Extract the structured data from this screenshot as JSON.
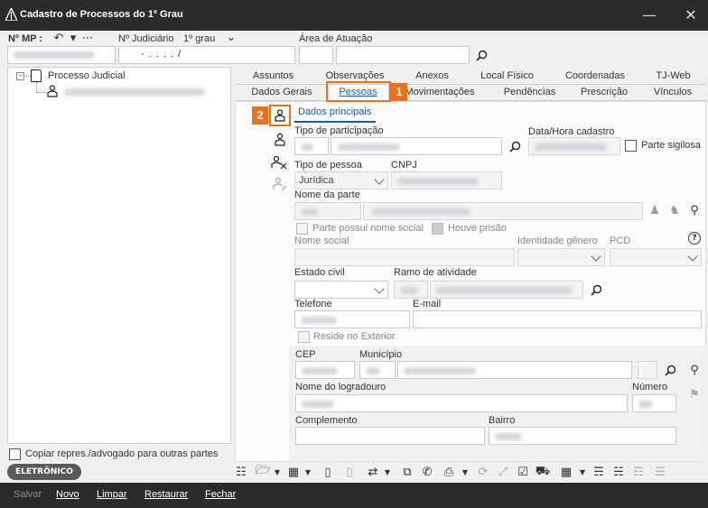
{
  "window": {
    "title": "Cadastro de Processos do 1º Grau",
    "minimize_icon": "minimize-icon",
    "close_icon": "close-icon"
  },
  "header": {
    "mp_label": "Nº MP :",
    "judiciario_label": "Nº Judiciário",
    "grau_label": "1º grau",
    "judiciario_mask": "- .  . . .  /",
    "area_label": "Área de Atuação"
  },
  "tree": {
    "root_label": "Processo Judicial"
  },
  "tabs_top": [
    "Assuntos",
    "Observações",
    "Anexos",
    "Local Físico",
    "Coordenadas",
    "TJ-Web"
  ],
  "tabs_bottom": [
    "Dados Gerais",
    "Pessoas",
    "Movimentações",
    "Pendências",
    "Prescrição",
    "Vínculos"
  ],
  "callouts": {
    "one": "1",
    "two": "2"
  },
  "subtab": "Dados principais",
  "form": {
    "tipo_participacao_label": "Tipo de participação",
    "data_hora_label": "Data/Hora cadastro",
    "parte_sigilosa_label": "Parte sigilosa",
    "tipo_pessoa_label": "Tipo de pessoa",
    "tipo_pessoa_value": "Jurídica",
    "cnpj_label": "CNPJ",
    "nome_parte_label": "Nome da parte",
    "nome_social_check_label": "Parte possui nome social",
    "houve_prisao_label": "Houve prisão",
    "nome_social_label": "Nome social",
    "identidade_genero_label": "Identidade gênero",
    "pcd_label": "PCD",
    "estado_civil_label": "Estado civil",
    "ramo_atividade_label": "Ramo de atividade",
    "telefone_label": "Telefone",
    "email_label": "E-mail",
    "reside_exterior_label": "Reside no Exterior",
    "cep_label": "CEP",
    "municipio_label": "Município",
    "logradouro_label": "Nome do logradouro",
    "numero_label": "Número",
    "complemento_label": "Complemento",
    "bairro_label": "Bairro"
  },
  "copy_checkbox_label": "Copiar repres./advogado para outras partes",
  "badge": "ELETRÔNICO",
  "actions": [
    "Salvar",
    "Novo",
    "Limpar",
    "Restaurar",
    "Fechar"
  ]
}
